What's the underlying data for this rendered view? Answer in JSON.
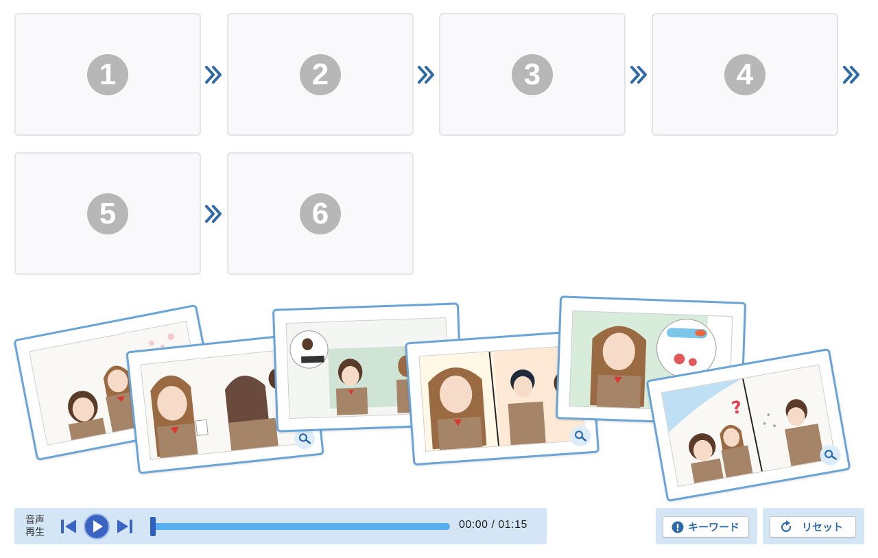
{
  "slots": [
    "1",
    "2",
    "3",
    "4",
    "5",
    "6"
  ],
  "cards": [
    {
      "name": "card-school-entrance-cherry-blossoms",
      "icon": "search-icon"
    },
    {
      "name": "card-girl-holding-paper",
      "icon": "search-icon"
    },
    {
      "name": "card-piano-memory-classroom",
      "icon": "search-icon"
    },
    {
      "name": "card-girl-laughing-boy-smiling",
      "icon": "search-icon"
    },
    {
      "name": "card-girl-thinking-swimming-drums",
      "icon": "search-icon"
    },
    {
      "name": "card-girls-question-boy-sneezing",
      "icon": "search-icon"
    }
  ],
  "player": {
    "label": "音声再生",
    "current_time": "00:00",
    "total_time": "01:15",
    "time_display": "00:00 / 01:15",
    "progress": 0
  },
  "buttons": {
    "keyword": "キーワード",
    "reset": "リセット"
  },
  "colors": {
    "accent": "#2f6aa8",
    "card_border": "#6aa3d6",
    "panel_bg": "#d4e6f6",
    "track": "#57aef0",
    "slot_number": "#b7b7b7"
  }
}
